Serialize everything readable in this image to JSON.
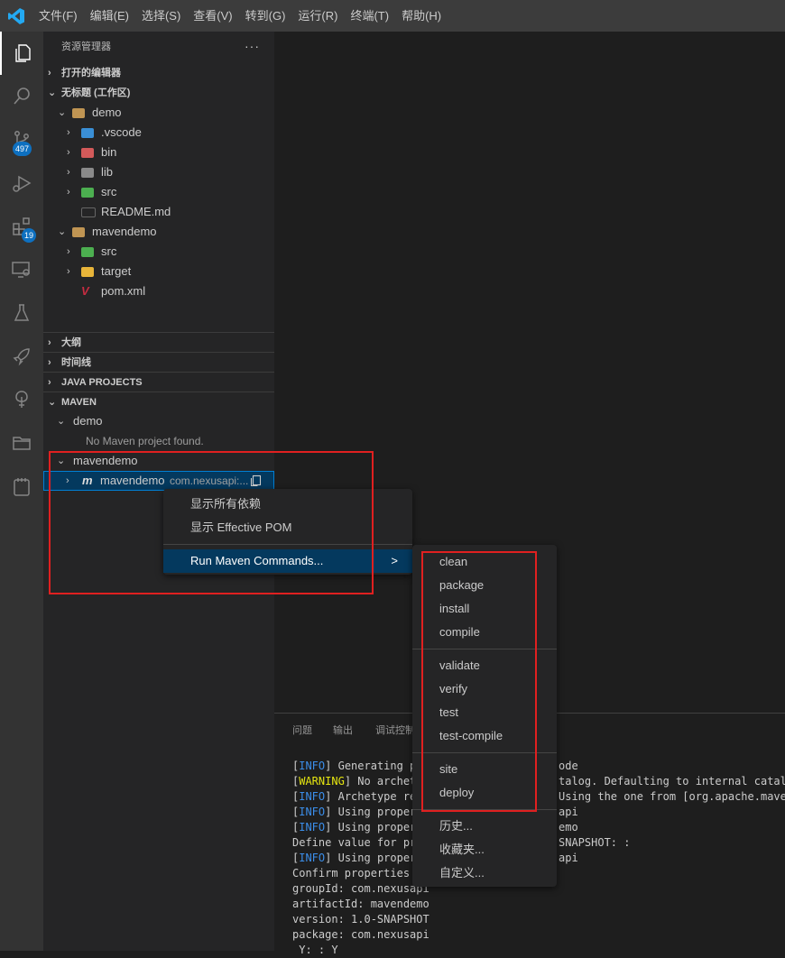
{
  "menubar": [
    "文件(F)",
    "编辑(E)",
    "选择(S)",
    "查看(V)",
    "转到(G)",
    "运行(R)",
    "终端(T)",
    "帮助(H)"
  ],
  "activity_bar": {
    "scm_badge": "497",
    "extensions_badge": "19"
  },
  "explorer": {
    "title": "资源管理器",
    "more": "···",
    "open_editors": "打开的编辑器",
    "workspace": "无标题 (工作区)",
    "tree": [
      {
        "label": "demo",
        "indent": 1,
        "chevron": "v",
        "icon": "folder-open",
        "color": "#c09553"
      },
      {
        "label": ".vscode",
        "indent": 2,
        "chevron": ">",
        "icon": "folder",
        "color": "#3a8fd6"
      },
      {
        "label": "bin",
        "indent": 2,
        "chevron": ">",
        "icon": "folder",
        "color": "#d35a5a"
      },
      {
        "label": "lib",
        "indent": 2,
        "chevron": ">",
        "icon": "folder",
        "color": "#8a8a8a"
      },
      {
        "label": "src",
        "indent": 2,
        "chevron": ">",
        "icon": "folder",
        "color": "#4caf50"
      },
      {
        "label": "README.md",
        "indent": 2,
        "chevron": "",
        "icon": "markdown",
        "color": "#666666"
      },
      {
        "label": "mavendemo",
        "indent": 1,
        "chevron": "v",
        "icon": "folder-open",
        "color": "#c09553"
      },
      {
        "label": "src",
        "indent": 2,
        "chevron": ">",
        "icon": "folder",
        "color": "#4caf50"
      },
      {
        "label": "target",
        "indent": 2,
        "chevron": ">",
        "icon": "folder",
        "color": "#e8b53a"
      },
      {
        "label": "pom.xml",
        "indent": 2,
        "chevron": "",
        "icon": "maven",
        "color": "#c72c41"
      }
    ],
    "outline": "大纲",
    "timeline": "时间线",
    "java_projects": "JAVA PROJECTS",
    "maven": "MAVEN"
  },
  "maven_tree": {
    "demo": "demo",
    "demo_msg": "No Maven project found.",
    "mavendemo_group": "mavendemo",
    "mavendemo_item": "mavendemo",
    "mavendemo_desc": "com.nexusapi:..."
  },
  "context_menu": {
    "items": [
      "显示所有依赖",
      "显示 Effective POM"
    ],
    "run_maven": "Run Maven Commands...",
    "arrow": ">"
  },
  "submenu": {
    "groups": [
      [
        "clean",
        "package",
        "install",
        "compile"
      ],
      [
        "validate",
        "verify",
        "test",
        "test-compile"
      ],
      [
        "site",
        "deploy"
      ],
      [
        "历史...",
        "收藏夹...",
        "自定义..."
      ]
    ]
  },
  "panel": {
    "tabs": [
      "问题",
      "输出",
      "调试控制"
    ],
    "lines": [
      {
        "tag": "INFO",
        "left": "] Generating p",
        "right": "ode"
      },
      {
        "tag": "WARNING",
        "left": "] No archet",
        "right": "talog. Defaulting to internal catalog"
      },
      {
        "tag": "INFO",
        "left": "] Archetype re",
        "right": "Using the one from [org.apache.maven."
      },
      {
        "tag": "INFO",
        "left": "] Using proper",
        "right": "api"
      },
      {
        "tag": "INFO",
        "left": "] Using proper",
        "right": "emo"
      },
      {
        "tag": "",
        "left": "Define value for pr",
        "right": "SNAPSHOT: :"
      },
      {
        "tag": "INFO",
        "left": "] Using proper",
        "right": "api"
      },
      {
        "tag": "",
        "left": "Confirm properties",
        "right": ""
      },
      {
        "tag": "",
        "left": "groupId: com.nexusapi",
        "right": ""
      },
      {
        "tag": "",
        "left": "artifactId: mavendemo",
        "right": ""
      },
      {
        "tag": "",
        "left": "version: 1.0-SNAPSHOT",
        "right": ""
      },
      {
        "tag": "",
        "left": "package: com.nexusapi",
        "right": ""
      },
      {
        "tag": "",
        "left": " Y: : Y",
        "right": ""
      }
    ]
  }
}
